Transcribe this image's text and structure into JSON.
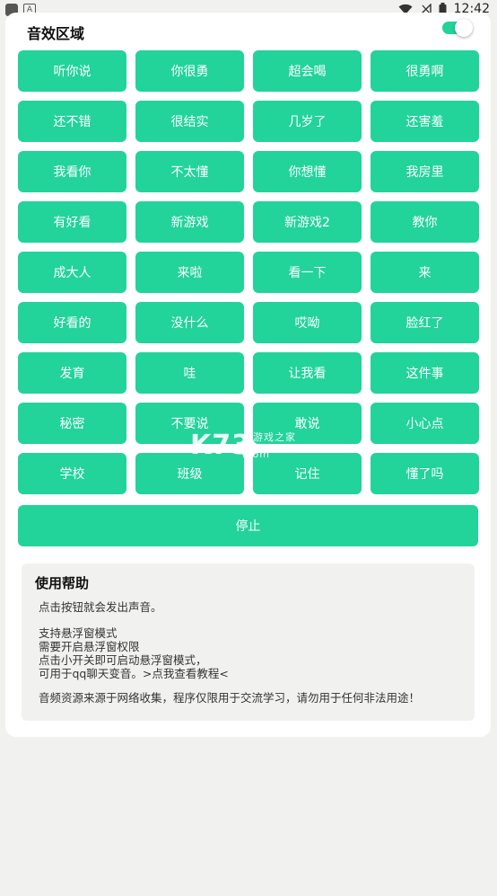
{
  "status_bar": {
    "time": "12:42",
    "notif_letter": "A"
  },
  "section": {
    "title": "音效区域",
    "toggle_on": true
  },
  "sound_buttons": [
    "听你说",
    "你很勇",
    "超会喝",
    "很勇啊",
    "还不错",
    "很结实",
    "几岁了",
    "还害羞",
    "我看你",
    "不太懂",
    "你想懂",
    "我房里",
    "有好看",
    "新游戏",
    "新游戏2",
    "教你",
    "成大人",
    "来啦",
    "看一下",
    "来",
    "好看的",
    "没什么",
    "哎呦",
    "脸红了",
    "发育",
    "哇",
    "让我看",
    "这件事",
    "秘密",
    "不要说",
    "敢说",
    "小心点",
    "学校",
    "班级",
    "记住",
    "懂了吗"
  ],
  "stop_label": "停止",
  "help": {
    "title": "使用帮助",
    "line1": "点击按钮就会发出声音。",
    "line2": "支持悬浮窗模式\n需要开启悬浮窗权限\n点击小开关即可启动悬浮窗模式，\n可用于qq聊天变音。>点我查看教程<",
    "line3": "音频资源来源于网络收集，程序仅限用于交流学习，请勿用于任何非法用途！"
  },
  "watermark": {
    "logo": "K73",
    "text": "游戏之家",
    "domain": ".com"
  },
  "colors": {
    "accent": "#22d39a",
    "background": "#f1f2f0"
  }
}
